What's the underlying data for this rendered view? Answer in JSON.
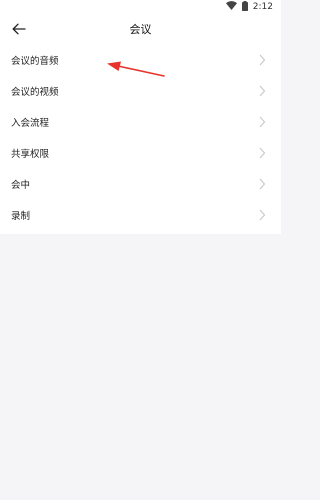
{
  "status": {
    "time": "2:12",
    "icons": [
      "wifi-icon",
      "battery-icon"
    ]
  },
  "header": {
    "title": "会议",
    "back_icon": "arrow-left-icon"
  },
  "menu": {
    "items": [
      {
        "label": "会议的音频"
      },
      {
        "label": "会议的视频"
      },
      {
        "label": "入会流程"
      },
      {
        "label": "共享权限"
      },
      {
        "label": "会中"
      },
      {
        "label": "录制"
      }
    ]
  },
  "annotation": {
    "color": "#e8322b",
    "icon": "red-arrow-annotation"
  }
}
